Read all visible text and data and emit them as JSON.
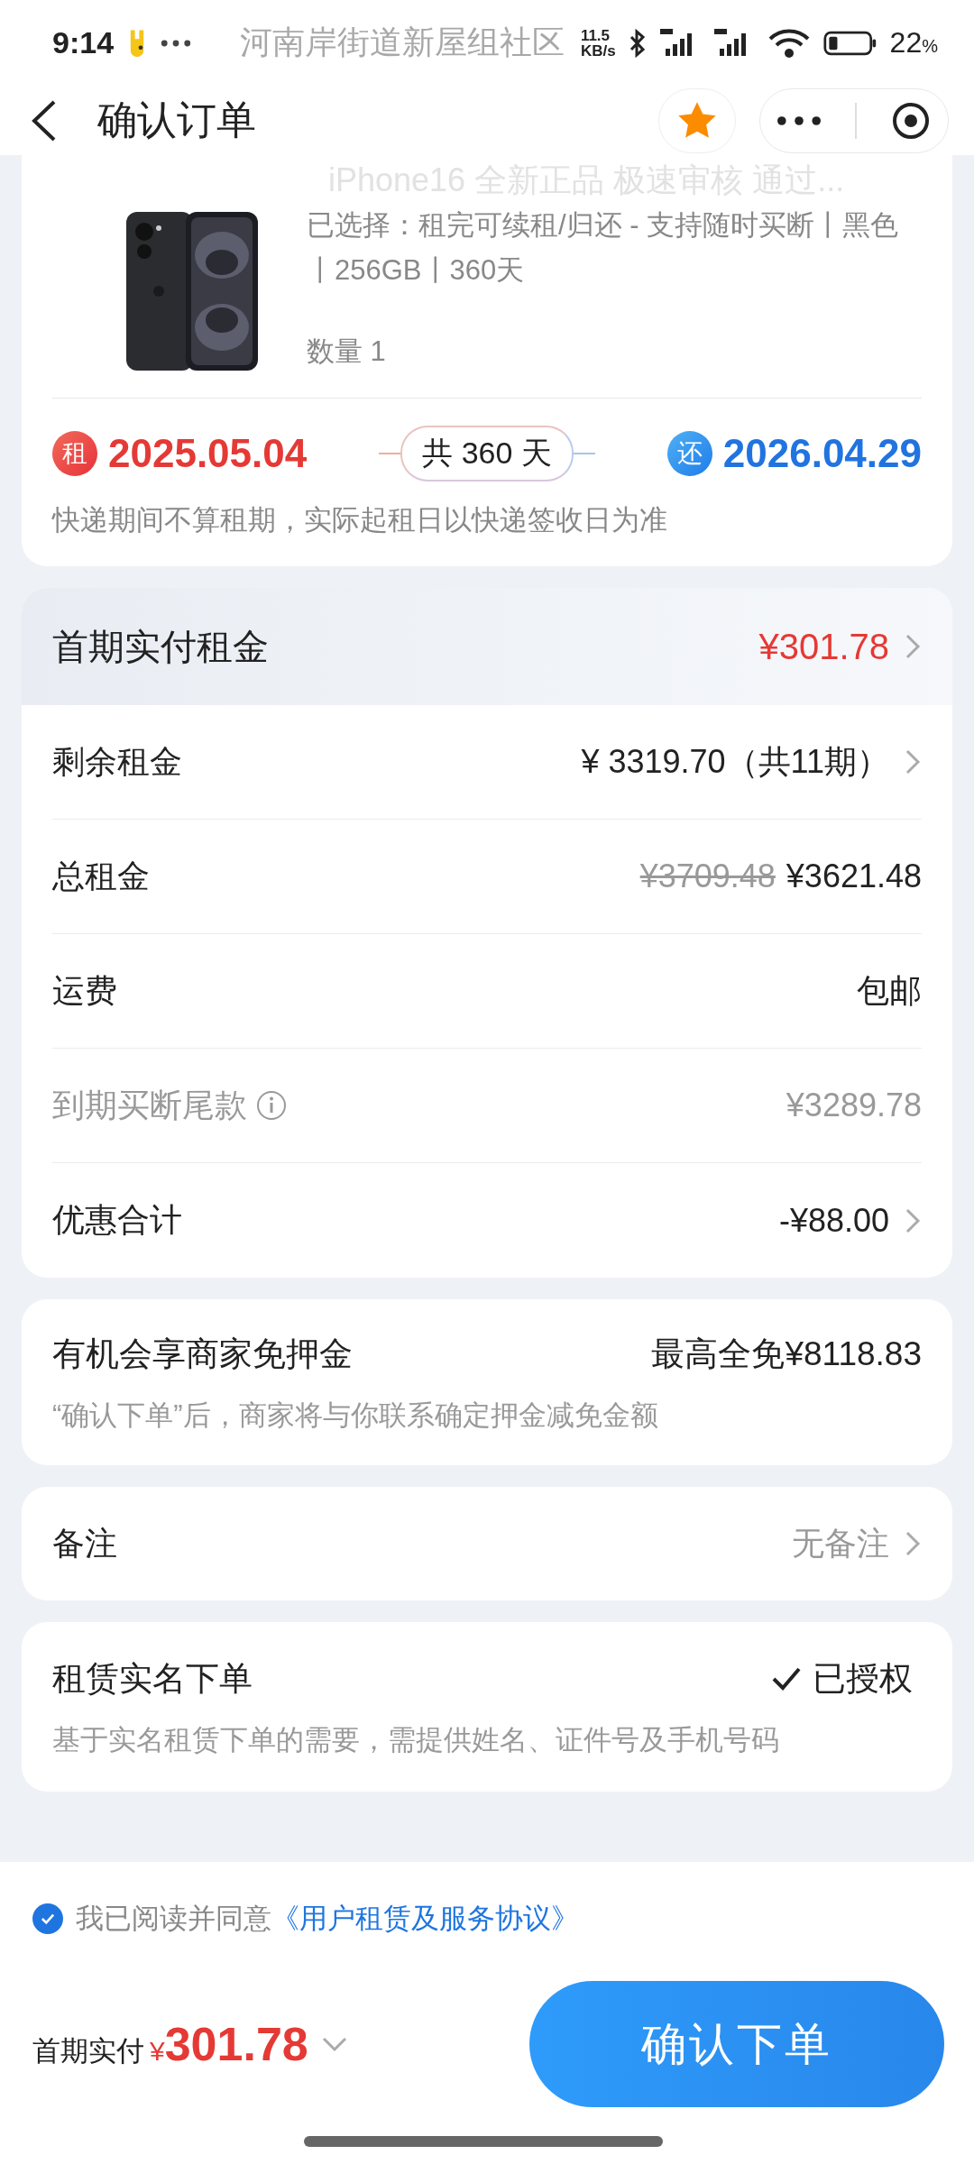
{
  "status_bar": {
    "time": "9:14",
    "notification": "河南岸街道新屋组社区",
    "speed_value": "11.5",
    "speed_unit": "KB/s",
    "battery": "22",
    "battery_unit": "%"
  },
  "header": {
    "title": "确认订单"
  },
  "product": {
    "title": "iPhone16 全新正品 极速审核 通过...",
    "spec": "已选择：租完可续租/归还 - 支持随时买断丨黑色丨256GB丨360天",
    "quantity": "数量 1"
  },
  "rental_period": {
    "start_badge": "租",
    "start_date": "2025.05.04",
    "duration": "共 360 天",
    "end_badge": "还",
    "end_date": "2026.04.29",
    "note": "快递期间不算租期，实际起租日以快递签收日为准"
  },
  "price_summary": {
    "header": {
      "label": "首期实付租金",
      "value": "¥301.78"
    },
    "rows": [
      {
        "label": "剩余租金",
        "value": "¥ 3319.70（共11期）",
        "chevron": true,
        "muted": false
      },
      {
        "label": "总租金",
        "original_value": "¥3709.48",
        "value": "¥3621.48",
        "chevron": false,
        "muted": false
      },
      {
        "label": "运费",
        "value": "包邮",
        "chevron": false,
        "muted": false
      },
      {
        "label": "到期买断尾款",
        "value": "¥3289.78",
        "info": true,
        "chevron": false,
        "muted": true
      },
      {
        "label": "优惠合计",
        "value": "-¥88.00",
        "chevron": true,
        "muted": false
      }
    ]
  },
  "deposit": {
    "title": "有机会享商家免押金",
    "value": "最高全免¥8118.83",
    "note": "“确认下单”后，商家将与你联系确定押金减免金额"
  },
  "remark": {
    "label": "备注",
    "value": "无备注"
  },
  "real_name": {
    "title": "租赁实名下单",
    "status": "已授权",
    "authorized": true,
    "note": "基于实名租赁下单的需要，需提供姓名、证件号及手机号码"
  },
  "footer": {
    "agreement": {
      "checked": true,
      "text": "我已阅读并同意",
      "link": "《用户租赁及服务协议》"
    },
    "total_label": "首期实付",
    "currency": "¥",
    "total": "301.78",
    "submit": "确认下单"
  }
}
